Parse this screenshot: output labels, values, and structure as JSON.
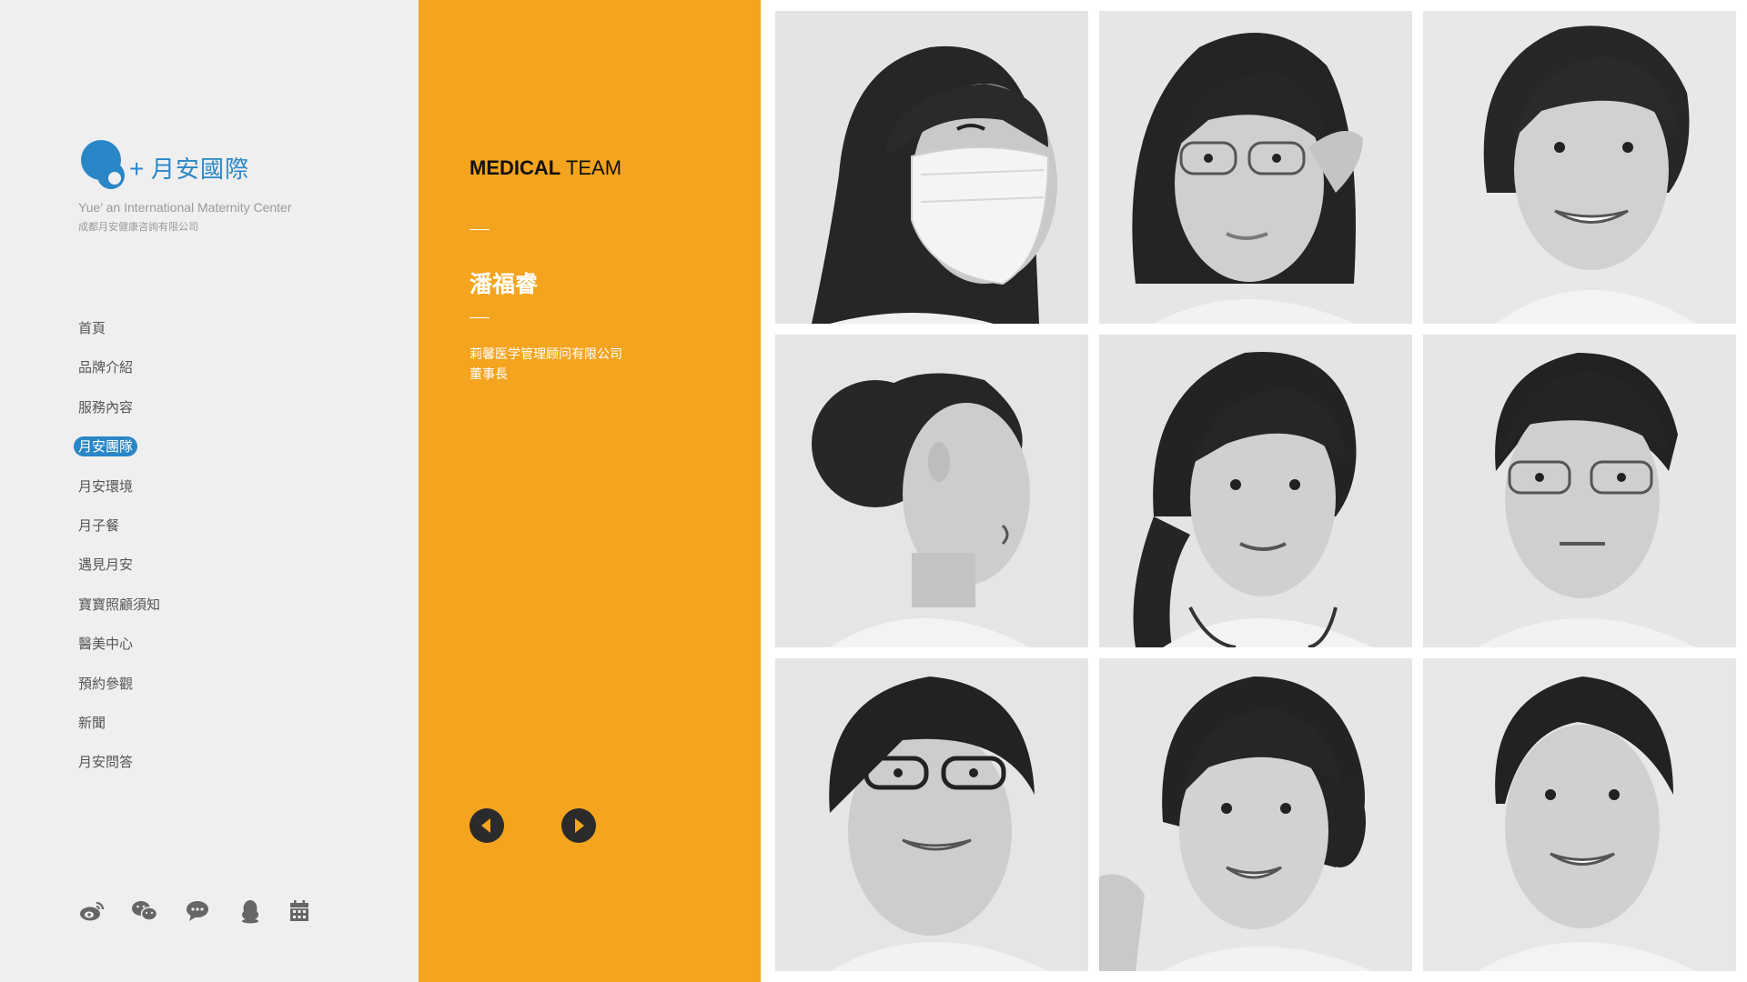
{
  "brand": {
    "name": "月安國際",
    "plus": "+",
    "english_name": "Yue’ an International  Maternity Center",
    "company": "成都月安健康咨詢有限公司",
    "color": "#2a87c7"
  },
  "nav": {
    "items": [
      {
        "label": "首頁",
        "active": false
      },
      {
        "label": "品牌介紹",
        "active": false
      },
      {
        "label": "服務內容",
        "active": false
      },
      {
        "label": "月安團隊",
        "active": true
      },
      {
        "label": "月安環境",
        "active": false
      },
      {
        "label": "月子餐",
        "active": false
      },
      {
        "label": "遇見月安",
        "active": false
      },
      {
        "label": "寶寶照顧須知",
        "active": false
      },
      {
        "label": "醫美中心",
        "active": false
      },
      {
        "label": "預約參觀",
        "active": false
      },
      {
        "label": "新聞",
        "active": false
      },
      {
        "label": "月安問答",
        "active": false
      }
    ]
  },
  "social": {
    "icons": [
      "weibo-icon",
      "wechat-icon",
      "chat-bubble-icon",
      "qq-icon",
      "calendar-icon"
    ]
  },
  "detail": {
    "title_bold": "MEDICAL",
    "title_light": " TEAM",
    "person_name": "潘福睿",
    "company": "莉馨医学管理顾问有限公司",
    "role": "董事長",
    "accent_color": "#f4a41f"
  },
  "controls": {
    "prev_icon": "arrow-left-icon",
    "next_icon": "arrow-right-icon"
  },
  "team_photos": [
    {
      "description": "woman-with-mask"
    },
    {
      "description": "woman-with-glasses"
    },
    {
      "description": "smiling-woman"
    },
    {
      "description": "woman-profile-bun"
    },
    {
      "description": "woman-with-stethoscope"
    },
    {
      "description": "man-with-glasses"
    },
    {
      "description": "young-man-with-glasses"
    },
    {
      "description": "smiling-young-woman"
    },
    {
      "description": "smiling-young-man"
    }
  ]
}
